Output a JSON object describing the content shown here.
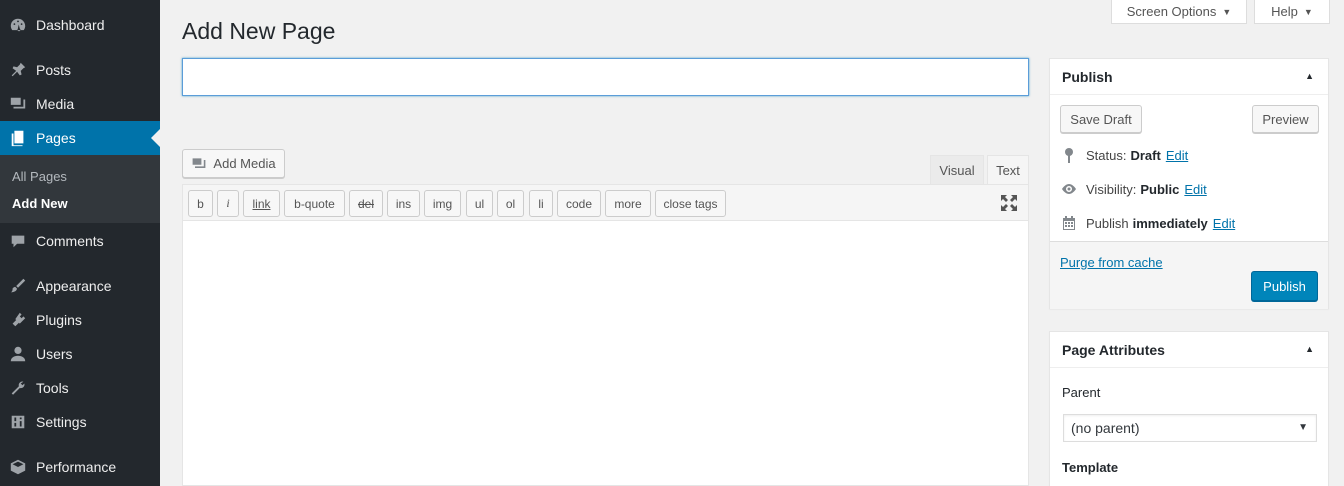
{
  "sidebar": {
    "items": [
      {
        "label": "Dashboard",
        "icon": "dashboard-icon"
      },
      {
        "label": "Posts",
        "icon": "pin-icon"
      },
      {
        "label": "Media",
        "icon": "media-icon"
      },
      {
        "label": "Pages",
        "icon": "pages-icon",
        "active": true
      },
      {
        "label": "Comments",
        "icon": "comment-icon"
      },
      {
        "label": "Appearance",
        "icon": "brush-icon"
      },
      {
        "label": "Plugins",
        "icon": "plugin-icon"
      },
      {
        "label": "Users",
        "icon": "user-icon"
      },
      {
        "label": "Tools",
        "icon": "wrench-icon"
      },
      {
        "label": "Settings",
        "icon": "settings-icon"
      },
      {
        "label": "Performance",
        "icon": "performance-icon"
      }
    ],
    "submenu": [
      {
        "label": "All Pages"
      },
      {
        "label": "Add New",
        "current": true
      }
    ]
  },
  "topbar": {
    "screen_options": "Screen Options",
    "help": "Help"
  },
  "page": {
    "title": "Add New Page",
    "title_input_value": ""
  },
  "editor": {
    "add_media": "Add Media",
    "tab_visual": "Visual",
    "tab_text": "Text",
    "quicktags": [
      "b",
      "i",
      "link",
      "b-quote",
      "del",
      "ins",
      "img",
      "ul",
      "ol",
      "li",
      "code",
      "more",
      "close tags"
    ]
  },
  "publish": {
    "title": "Publish",
    "save_draft": "Save Draft",
    "preview": "Preview",
    "status_label": "Status:",
    "status_value": "Draft",
    "visibility_label": "Visibility:",
    "visibility_value": "Public",
    "publish_label": "Publish",
    "publish_value": "immediately",
    "edit": "Edit",
    "purge": "Purge from cache",
    "publish_button": "Publish"
  },
  "attributes": {
    "title": "Page Attributes",
    "parent_label": "Parent",
    "parent_value": "(no parent)",
    "template_label": "Template"
  },
  "colors": {
    "sidebar_bg": "#23282d",
    "accent": "#0073aa",
    "primary_button": "#0085ba"
  }
}
